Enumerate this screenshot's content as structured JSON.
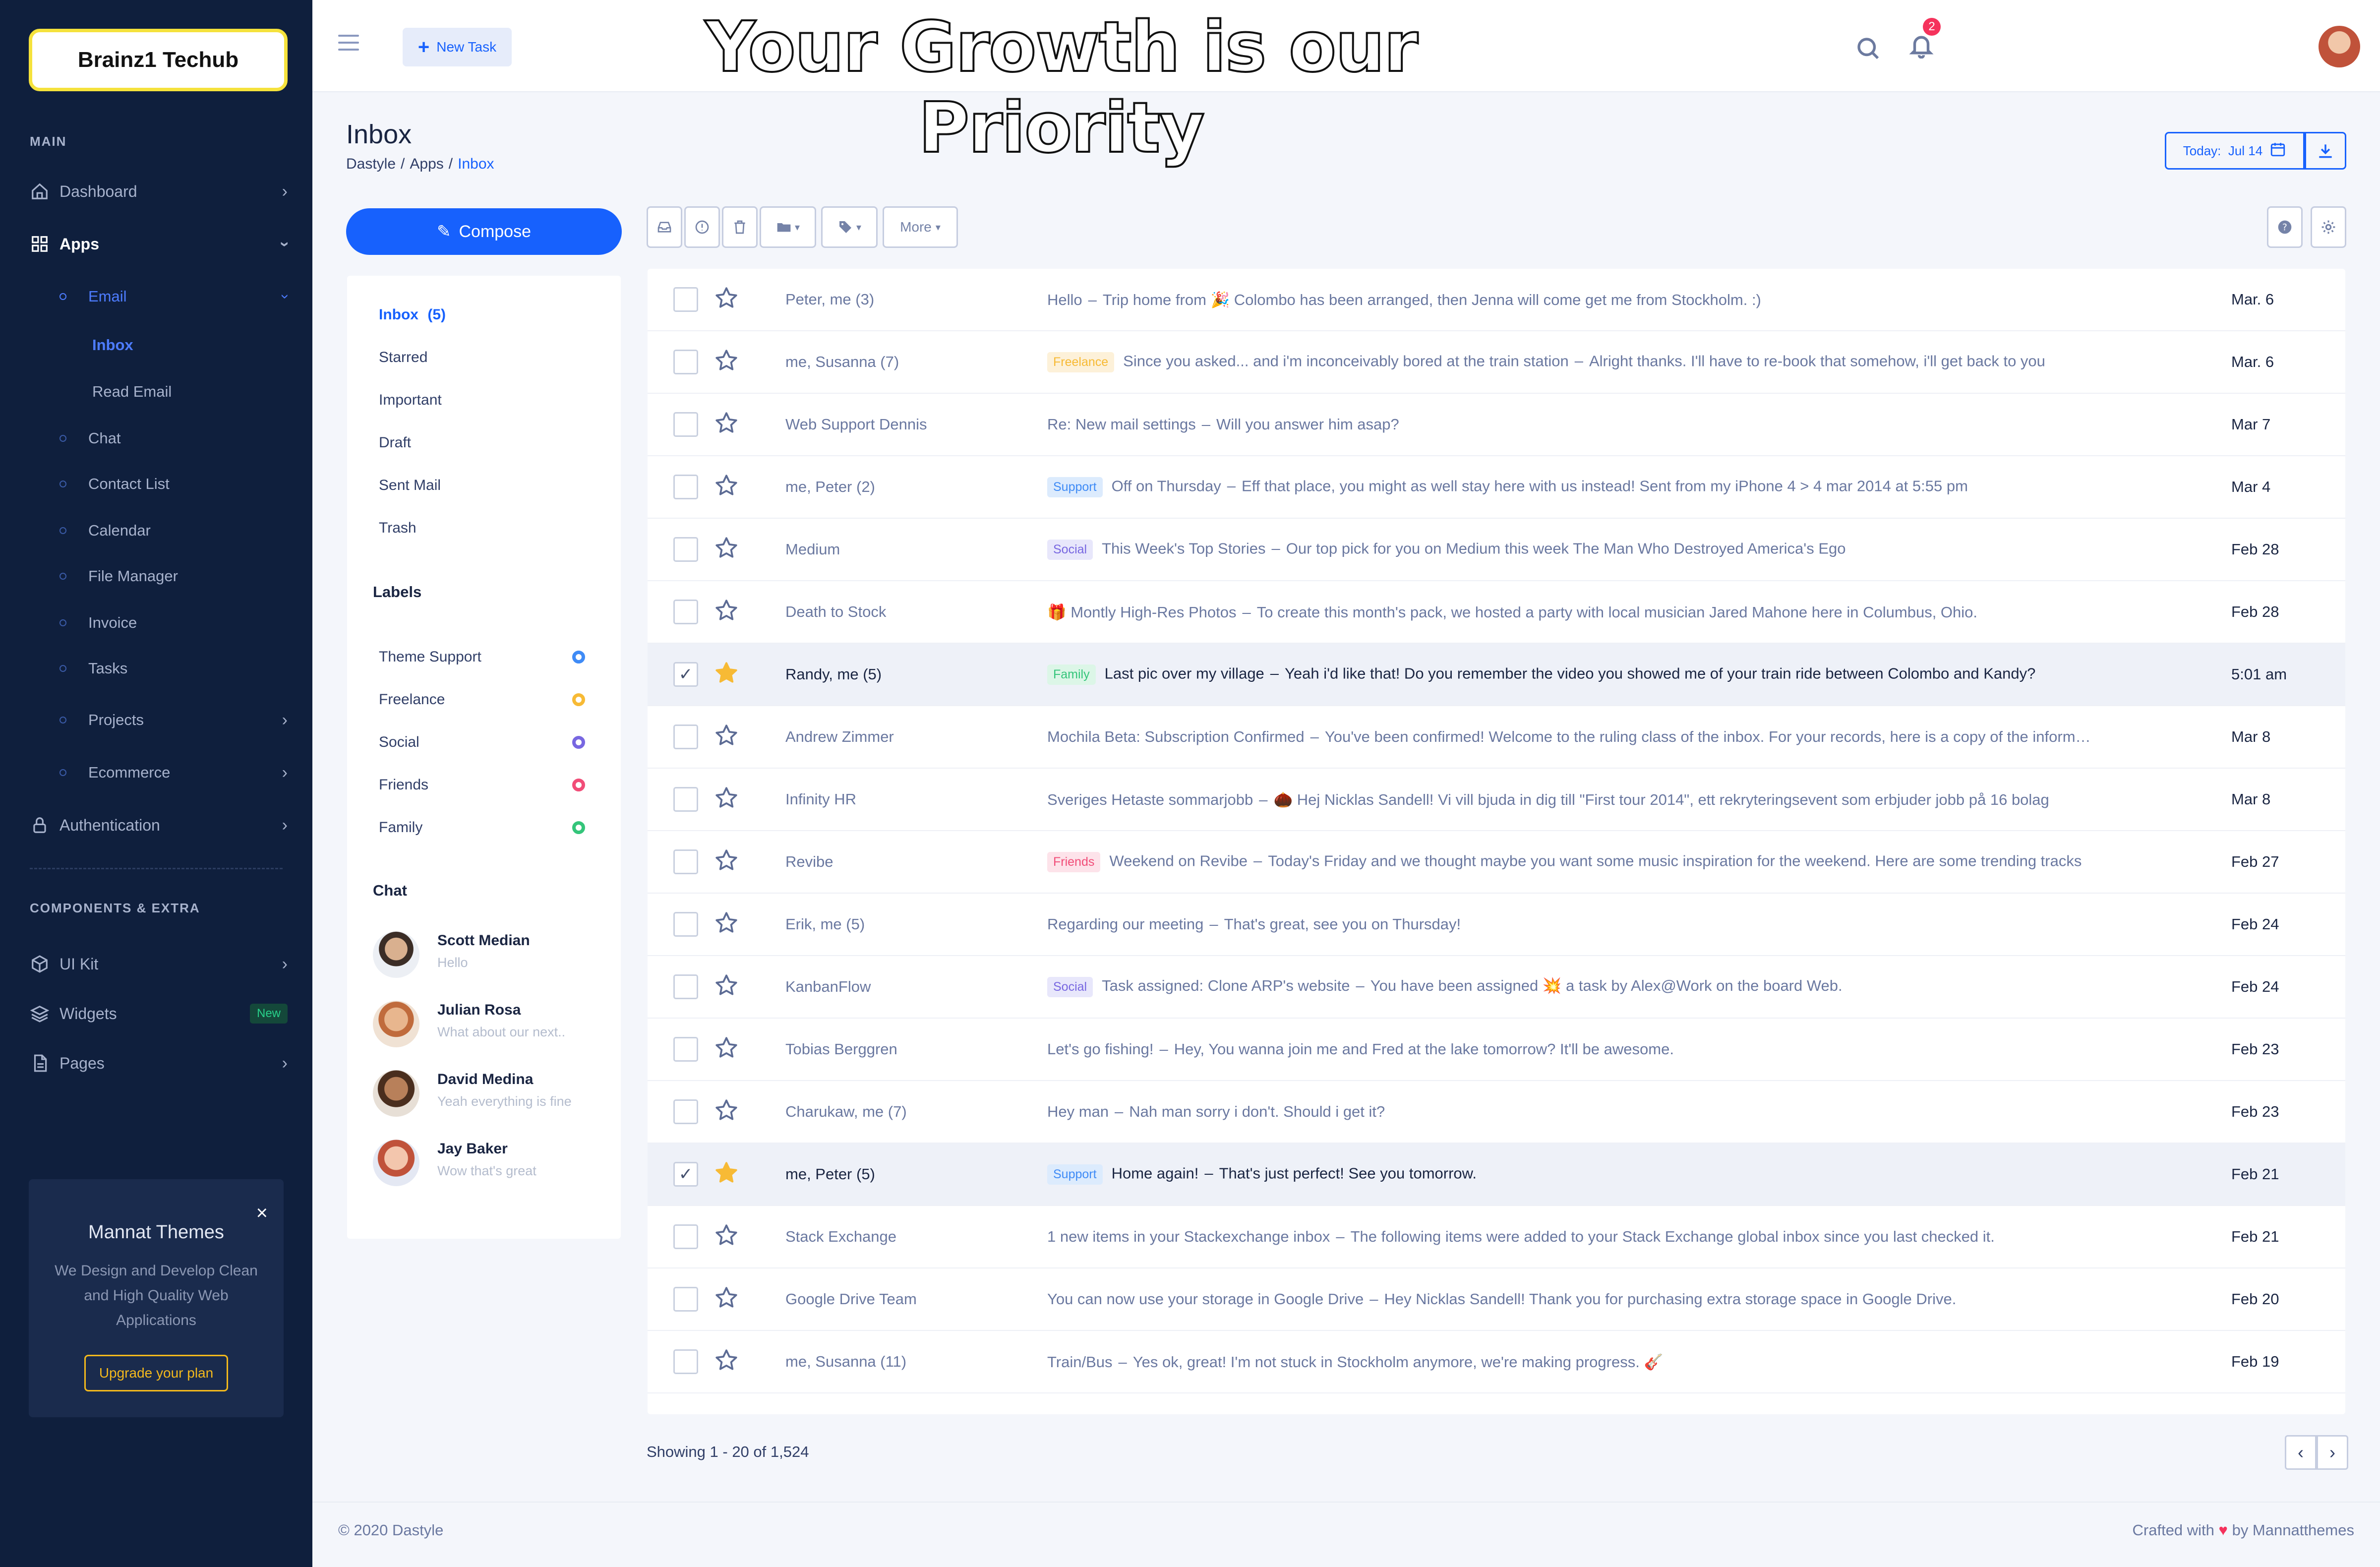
{
  "brand": "Brainz1 Techub",
  "banner": "Your Growth is our Priority",
  "sidebar": {
    "section_main": "MAIN",
    "dashboard": "Dashboard",
    "apps": "Apps",
    "email": "Email",
    "inbox": "Inbox",
    "read_email": "Read Email",
    "chat": "Chat",
    "contact_list": "Contact List",
    "calendar": "Calendar",
    "file_manager": "File Manager",
    "invoice": "Invoice",
    "tasks": "Tasks",
    "projects": "Projects",
    "ecommerce": "Ecommerce",
    "authentication": "Authentication",
    "section_components": "COMPONENTS & EXTRA",
    "ui_kit": "UI Kit",
    "widgets": "Widgets",
    "widgets_badge": "New",
    "pages": "Pages"
  },
  "promo": {
    "close": "×",
    "title": "Mannat Themes",
    "description": "We Design and Develop Clean and High Quality Web Applications",
    "button": "Upgrade your plan"
  },
  "topbar": {
    "new_task": "New Task",
    "notification_count": "2"
  },
  "header": {
    "title": "Inbox",
    "crumb_1": "Dastyle",
    "crumb_2": "Apps",
    "crumb_3": "Inbox",
    "today": "Today:  Jul 14"
  },
  "compose": "Compose",
  "folders": {
    "inbox": "Inbox",
    "inbox_count": "(5)",
    "starred": "Starred",
    "important": "Important",
    "draft": "Draft",
    "sent": "Sent Mail",
    "trash": "Trash"
  },
  "labels_heading": "Labels",
  "labels": [
    {
      "name": "Theme Support",
      "color": "#3f8bf6"
    },
    {
      "name": "Freelance",
      "color": "#f7ba35"
    },
    {
      "name": "Social",
      "color": "#7867e1"
    },
    {
      "name": "Friends",
      "color": "#f14d78"
    },
    {
      "name": "Family",
      "color": "#34c57a"
    }
  ],
  "chat_heading": "Chat",
  "chats": [
    {
      "name": "Scott Median",
      "message": "Hello"
    },
    {
      "name": "Julian Rosa",
      "message": "What about our next.."
    },
    {
      "name": "David Medina",
      "message": "Yeah everything is fine"
    },
    {
      "name": "Jay Baker",
      "message": "Wow that's great"
    }
  ],
  "toolbar": {
    "more": "More"
  },
  "emails": [
    {
      "from": "Peter, me (3)",
      "tag": "",
      "subject": "Hello",
      "preview": "Trip home from 🎉 Colombo has been arranged, then Jenna will come get me from Stockholm. :)",
      "date": "Mar. 6",
      "checked": false,
      "starred": false
    },
    {
      "from": "me, Susanna (7)",
      "tag": "Freelance",
      "subject": "Since you asked... and i'm inconceivably bored at the train station",
      "preview": "Alright thanks. I'll have to re-book that somehow, i'll get back to you",
      "date": "Mar. 6",
      "checked": false,
      "starred": false
    },
    {
      "from": "Web Support Dennis",
      "tag": "",
      "subject": "Re: New mail settings",
      "preview": "Will you answer him asap?",
      "date": "Mar 7",
      "checked": false,
      "starred": false
    },
    {
      "from": "me, Peter (2)",
      "tag": "Support",
      "subject": "Off on Thursday",
      "preview": "Eff that place, you might as well stay here with us instead! Sent from my iPhone 4 > 4 mar 2014 at 5:55 pm",
      "date": "Mar 4",
      "checked": false,
      "starred": false
    },
    {
      "from": "Medium",
      "tag": "Social",
      "subject": "This Week's Top Stories",
      "preview": "Our top pick for you on Medium this week The Man Who Destroyed America's Ego",
      "date": "Feb 28",
      "checked": false,
      "starred": false
    },
    {
      "from": "Death to Stock",
      "tag": "",
      "subject": "🎁 Montly High-Res Photos",
      "preview": "To create this month's pack, we hosted a party with local musician Jared Mahone here in Columbus, Ohio.",
      "date": "Feb 28",
      "checked": false,
      "starred": false
    },
    {
      "from": "Randy, me (5)",
      "tag": "Family",
      "subject": "Last pic over my village",
      "preview": "Yeah i'd like that! Do you remember the video you showed me of your train ride between Colombo and Kandy?",
      "date": "5:01 am",
      "checked": true,
      "starred": true
    },
    {
      "from": "Andrew Zimmer",
      "tag": "",
      "subject": "Mochila Beta: Subscription Confirmed",
      "preview": "You've been confirmed! Welcome to the ruling class of the inbox. For your records, here is a copy of the information you submitted",
      "date": "Mar 8",
      "checked": false,
      "starred": false
    },
    {
      "from": "Infinity HR",
      "tag": "",
      "subject": "Sveriges Hetaste sommarjobb",
      "preview": "🌰 Hej Nicklas Sandell! Vi vill bjuda in dig till \"First tour 2014\", ett rekryteringsevent som erbjuder jobb på 16 bolag",
      "date": "Mar 8",
      "checked": false,
      "starred": false
    },
    {
      "from": "Revibe",
      "tag": "Friends",
      "subject": "Weekend on Revibe",
      "preview": "Today's Friday and we thought maybe you want some music inspiration for the weekend. Here are some trending tracks",
      "date": "Feb 27",
      "checked": false,
      "starred": false
    },
    {
      "from": "Erik, me (5)",
      "tag": "",
      "subject": "Regarding our meeting",
      "preview": "That's great, see you on Thursday!",
      "date": "Feb 24",
      "checked": false,
      "starred": false
    },
    {
      "from": "KanbanFlow",
      "tag": "Social",
      "subject": "Task assigned: Clone ARP's website",
      "preview": "You have been assigned 💥 a task by Alex@Work on the board Web.",
      "date": "Feb 24",
      "checked": false,
      "starred": false
    },
    {
      "from": "Tobias Berggren",
      "tag": "",
      "subject": "Let's go fishing!",
      "preview": "Hey, You wanna join me and Fred at the lake tomorrow? It'll be awesome.",
      "date": "Feb 23",
      "checked": false,
      "starred": false
    },
    {
      "from": "Charukaw, me (7)",
      "tag": "",
      "subject": "Hey man",
      "preview": "Nah man sorry i don't. Should i get it?",
      "date": "Feb 23",
      "checked": false,
      "starred": false
    },
    {
      "from": "me, Peter (5)",
      "tag": "Support",
      "subject": "Home again!",
      "preview": "That's just perfect! See you tomorrow.",
      "date": "Feb 21",
      "checked": true,
      "starred": true
    },
    {
      "from": "Stack Exchange",
      "tag": "",
      "subject": "1 new items in your Stackexchange inbox",
      "preview": "The following items were added to your Stack Exchange global inbox since you last checked it.",
      "date": "Feb 21",
      "checked": false,
      "starred": false
    },
    {
      "from": "Google Drive Team",
      "tag": "",
      "subject": "You can now use your storage in Google Drive",
      "preview": "Hey Nicklas Sandell! Thank you for purchasing extra storage space in Google Drive.",
      "date": "Feb 20",
      "checked": false,
      "starred": false
    },
    {
      "from": "me, Susanna (11)",
      "tag": "",
      "subject": "Train/Bus",
      "preview": "Yes ok, great! I'm not stuck in Stockholm anymore, we're making progress. 🎸",
      "date": "Feb 19",
      "checked": false,
      "starred": false
    }
  ],
  "showing": "Showing 1 - 20 of 1,524",
  "footer": {
    "copyright": "© 2020 Dastyle",
    "crafted_prefix": "Crafted with",
    "crafted_suffix": "by Mannatthemes"
  }
}
